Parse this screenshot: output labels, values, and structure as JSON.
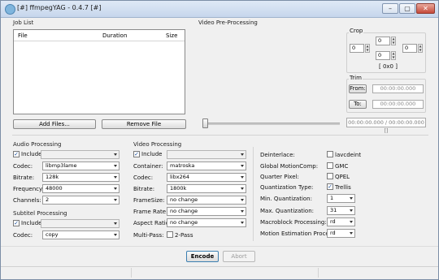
{
  "window": {
    "title": "[#] ffmpegYAG - 0.4.7 [#]",
    "minimize": "–",
    "maximize": "▢",
    "close": "✕"
  },
  "job_list": {
    "group": "Job List",
    "columns": [
      "File",
      "Duration",
      "Size"
    ],
    "add_button": "Add Files...",
    "remove_button": "Remove File"
  },
  "video_pre": {
    "group": "Video Pre-Processing",
    "crop": {
      "label": "Crop",
      "top": "0",
      "left": "0",
      "right": "0",
      "bottom": "0",
      "result": "[ 0x0 ]"
    },
    "trim": {
      "label": "Trim",
      "from_button": "From:",
      "to_button": "To:",
      "from_value": "00:00:00.000",
      "to_value": "00:00:00.000"
    },
    "slider": {
      "position": 0
    },
    "time_display": "00:00:00.000 / 00:00:00.000 []"
  },
  "audio": {
    "group": "Audio Processing",
    "include_label": "Include",
    "include_checked": true,
    "fields": [
      {
        "label": "Codec:",
        "value": "libmp3lame"
      },
      {
        "label": "Bitrate:",
        "value": "128k"
      },
      {
        "label": "Frequency:",
        "value": "48000"
      },
      {
        "label": "Channels:",
        "value": "2"
      }
    ]
  },
  "subtitle": {
    "group": "Subtitel Processing",
    "include_label": "Include",
    "include_checked": true,
    "codec_label": "Codec:",
    "codec_value": "copy"
  },
  "video": {
    "group": "Video Processing",
    "include_label": "Include",
    "include_checked": true,
    "fields": [
      {
        "label": "Container:",
        "value": "matroska"
      },
      {
        "label": "Codec:",
        "value": "libx264"
      },
      {
        "label": "Bitrate:",
        "value": "1800k"
      },
      {
        "label": "FrameSize:",
        "value": "no change"
      },
      {
        "label": "Frame Rate:",
        "value": "no change"
      },
      {
        "label": "Aspect Ratio:",
        "value": "no change"
      }
    ],
    "multipass_label": "Multi-Pass:",
    "twopass_label": "2-Pass",
    "twopass_checked": false
  },
  "advanced": {
    "checks": [
      {
        "label": "Deinterlace:",
        "option": "lavcdeint",
        "checked": false
      },
      {
        "label": "Global MotionComp:",
        "option": "GMC",
        "checked": false
      },
      {
        "label": "Quarter Pixel:",
        "option": "QPEL",
        "checked": false
      },
      {
        "label": "Quantization Type:",
        "option": "Trellis",
        "checked": true
      }
    ],
    "combos": [
      {
        "label": "Min. Quantization:",
        "value": "1"
      },
      {
        "label": "Max. Quantization:",
        "value": "31"
      },
      {
        "label": "Macroblock Processing:",
        "value": "rd"
      },
      {
        "label": "Motion Estimation Processing:",
        "value": "rd"
      }
    ]
  },
  "footer": {
    "encode_button": "Encode",
    "abort_button": "Abort"
  }
}
